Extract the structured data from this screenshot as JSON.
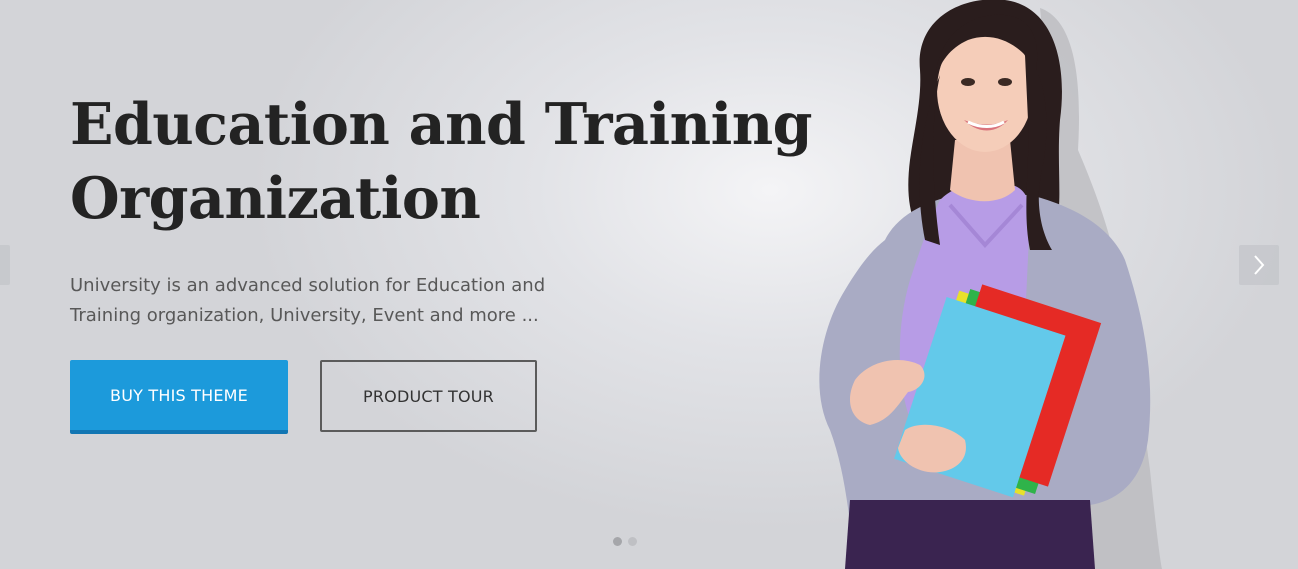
{
  "hero": {
    "title_line1": "Education and Training",
    "title_line2": "Organization",
    "subtitle_line1": "University is an advanced solution for Education and",
    "subtitle_line2": "Training organization, University, Event and more ..."
  },
  "buttons": {
    "buy_label": "BUY THIS THEME",
    "tour_label": "PRODUCT TOUR"
  },
  "slider": {
    "prev_icon": "chevron-left-icon",
    "next_icon": "chevron-right-icon",
    "slide_count": 2,
    "active_slide": 1
  },
  "colors": {
    "accent": "#1c9adb",
    "accent_dark": "#1276b3",
    "heading": "#232323",
    "body_text": "#585858"
  },
  "image": {
    "subject": "student-with-notebooks"
  }
}
